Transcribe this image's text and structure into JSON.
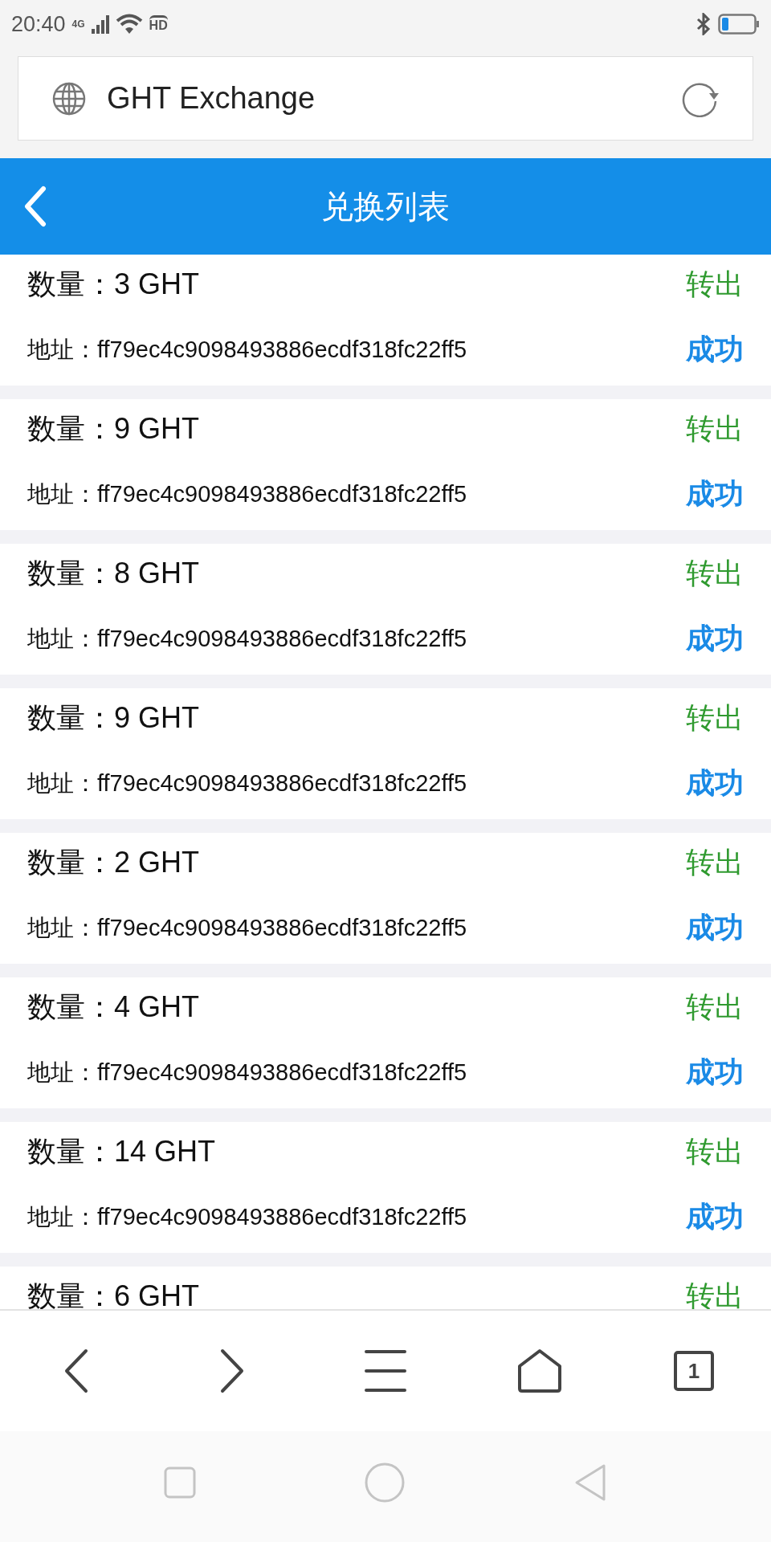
{
  "status_bar": {
    "time": "20:40",
    "network": "4G",
    "hd": "HD"
  },
  "address_bar": {
    "title": "GHT Exchange"
  },
  "header": {
    "title": "兑换列表"
  },
  "records": [
    {
      "amount": "数量：3 GHT",
      "direction": "转出",
      "address": "地址：ff79ec4c9098493886ecdf318fc22ff5",
      "status": "成功"
    },
    {
      "amount": "数量：9 GHT",
      "direction": "转出",
      "address": "地址：ff79ec4c9098493886ecdf318fc22ff5",
      "status": "成功"
    },
    {
      "amount": "数量：8 GHT",
      "direction": "转出",
      "address": "地址：ff79ec4c9098493886ecdf318fc22ff5",
      "status": "成功"
    },
    {
      "amount": "数量：9 GHT",
      "direction": "转出",
      "address": "地址：ff79ec4c9098493886ecdf318fc22ff5",
      "status": "成功"
    },
    {
      "amount": "数量：2 GHT",
      "direction": "转出",
      "address": "地址：ff79ec4c9098493886ecdf318fc22ff5",
      "status": "成功"
    },
    {
      "amount": "数量：4 GHT",
      "direction": "转出",
      "address": "地址：ff79ec4c9098493886ecdf318fc22ff5",
      "status": "成功"
    },
    {
      "amount": "数量：14 GHT",
      "direction": "转出",
      "address": "地址：ff79ec4c9098493886ecdf318fc22ff5",
      "status": "成功"
    },
    {
      "amount": "数量：6 GHT",
      "direction": "转出"
    }
  ],
  "browser_toolbar": {
    "tab_count": "1"
  }
}
